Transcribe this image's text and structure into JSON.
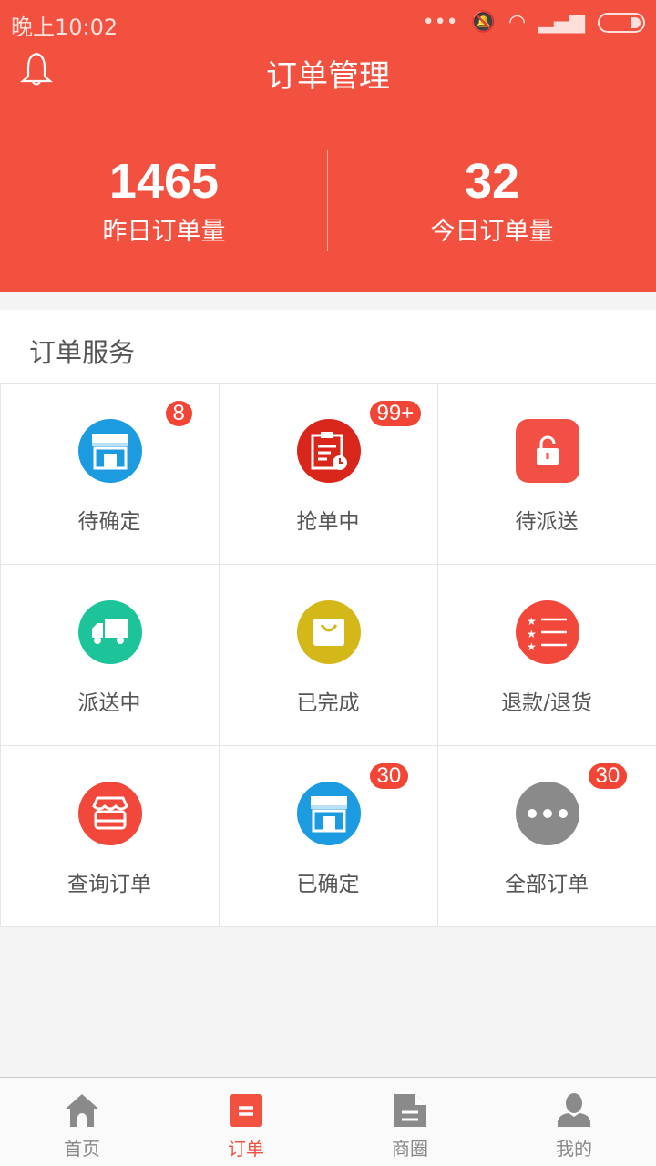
{
  "status": {
    "time": "晚上10:02"
  },
  "header": {
    "title": "订单管理"
  },
  "stats": [
    {
      "value": "1465",
      "label": "昨日订单量"
    },
    {
      "value": "32",
      "label": "今日订单量"
    }
  ],
  "section": {
    "title": "订单服务"
  },
  "services": [
    {
      "label": "待确定",
      "badge": "8",
      "icon": "store-icon",
      "color": "#1c9be0"
    },
    {
      "label": "抢单中",
      "badge": "99+",
      "icon": "clipboard-clock-icon",
      "color": "#d9261a"
    },
    {
      "label": "待派送",
      "badge": null,
      "icon": "unlock-icon",
      "color": "#f24f45"
    },
    {
      "label": "派送中",
      "badge": null,
      "icon": "truck-icon",
      "color": "#1dc49a"
    },
    {
      "label": "已完成",
      "badge": null,
      "icon": "bag-icon",
      "color": "#d4b81a"
    },
    {
      "label": "退款/退货",
      "badge": null,
      "icon": "star-list-icon",
      "color": "#f2473b"
    },
    {
      "label": "查询订单",
      "badge": null,
      "icon": "shop-search-icon",
      "color": "#f2473b"
    },
    {
      "label": "已确定",
      "badge": "30",
      "icon": "store-icon",
      "color": "#1c9be0"
    },
    {
      "label": "全部订单",
      "badge": "30",
      "icon": "more-icon",
      "color": "#8a8a8a"
    }
  ],
  "tabs": [
    {
      "label": "首页",
      "icon": "home-icon"
    },
    {
      "label": "订单",
      "icon": "order-icon",
      "active": true
    },
    {
      "label": "商圈",
      "icon": "document-icon"
    },
    {
      "label": "我的",
      "icon": "user-icon"
    }
  ]
}
